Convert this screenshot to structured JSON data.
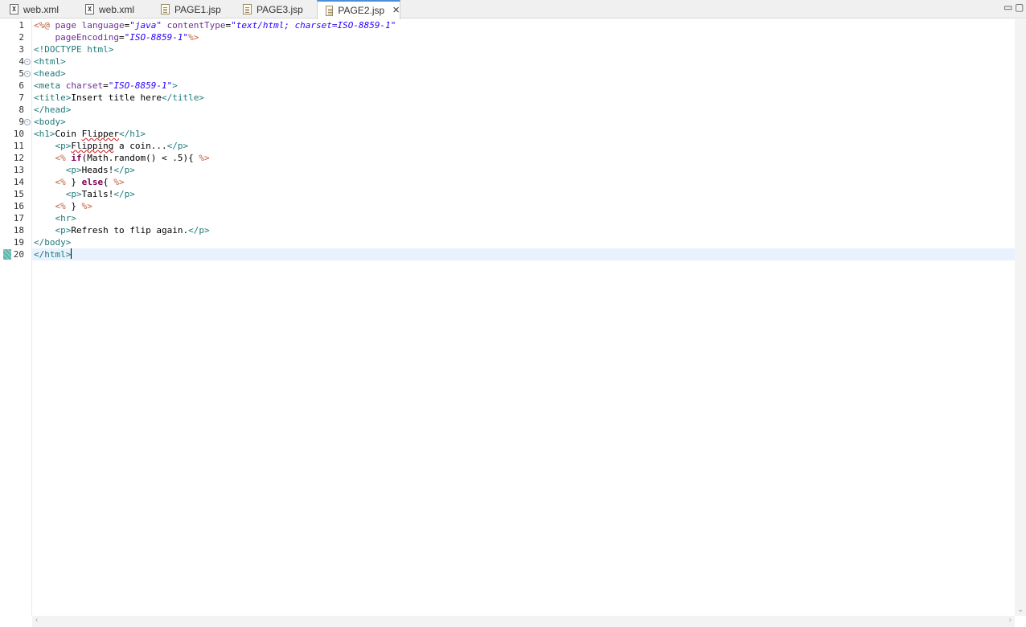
{
  "tabs": [
    {
      "label": "web.xml",
      "icon": "xml-file-icon",
      "active": false
    },
    {
      "label": "web.xml",
      "icon": "xml-file-icon",
      "active": false
    },
    {
      "label": "PAGE1.jsp",
      "icon": "jsp-file-icon",
      "active": false
    },
    {
      "label": "PAGE3.jsp",
      "icon": "jsp-file-icon",
      "active": false
    },
    {
      "label": "PAGE2.jsp",
      "icon": "jsp-file-icon",
      "active": true
    }
  ],
  "window_controls": {
    "minimize": "▭",
    "maximize": "▢"
  },
  "editor": {
    "line_numbers": [
      "1",
      "2",
      "3",
      "4",
      "5",
      "6",
      "7",
      "8",
      "9",
      "10",
      "11",
      "12",
      "13",
      "14",
      "15",
      "16",
      "17",
      "18",
      "19",
      "20"
    ],
    "folded_lines": [
      4,
      5,
      9
    ],
    "current_line": 20,
    "lines": [
      [
        [
          "jsp",
          "<%@ "
        ],
        [
          "attr",
          "page "
        ],
        [
          "attr",
          "language"
        ],
        [
          "txt",
          "="
        ],
        [
          "str",
          "\"java\""
        ],
        [
          "txt",
          " "
        ],
        [
          "attr",
          "contentType"
        ],
        [
          "txt",
          "="
        ],
        [
          "str",
          "\"text/html; charset=ISO-8859-1\""
        ]
      ],
      [
        [
          "txt",
          "    "
        ],
        [
          "attr",
          "pageEncoding"
        ],
        [
          "txt",
          "="
        ],
        [
          "str",
          "\"ISO-8859-1\""
        ],
        [
          "jsp",
          "%>"
        ]
      ],
      [
        [
          "tag",
          "<!DOCTYPE html>"
        ]
      ],
      [
        [
          "tag",
          "<html>"
        ]
      ],
      [
        [
          "tag",
          "<head>"
        ]
      ],
      [
        [
          "tag",
          "<meta "
        ],
        [
          "attr",
          "charset"
        ],
        [
          "txt",
          "="
        ],
        [
          "str",
          "\"ISO-8859-1\""
        ],
        [
          "tag",
          ">"
        ]
      ],
      [
        [
          "tag",
          "<title>"
        ],
        [
          "txt",
          "Insert title here"
        ],
        [
          "tag",
          "</title>"
        ]
      ],
      [
        [
          "tag",
          "</head>"
        ]
      ],
      [
        [
          "tag",
          "<body>"
        ]
      ],
      [
        [
          "tag",
          "<h1>"
        ],
        [
          "txt",
          "Coin "
        ],
        [
          "typo",
          "Flipper"
        ],
        [
          "tag",
          "</h1>"
        ]
      ],
      [
        [
          "txt",
          "    "
        ],
        [
          "tag",
          "<p>"
        ],
        [
          "typo",
          "Flipping"
        ],
        [
          "txt",
          " a coin..."
        ],
        [
          "tag",
          "</p>"
        ]
      ],
      [
        [
          "txt",
          "    "
        ],
        [
          "jsp",
          "<% "
        ],
        [
          "kw",
          "if"
        ],
        [
          "txt",
          "(Math.random() < .5){ "
        ],
        [
          "jsp",
          "%>"
        ]
      ],
      [
        [
          "txt",
          "      "
        ],
        [
          "tag",
          "<p>"
        ],
        [
          "txt",
          "Heads!"
        ],
        [
          "tag",
          "</p>"
        ]
      ],
      [
        [
          "txt",
          "    "
        ],
        [
          "jsp",
          "<% "
        ],
        [
          "txt",
          "} "
        ],
        [
          "kw",
          "else"
        ],
        [
          "txt",
          "{ "
        ],
        [
          "jsp",
          "%>"
        ]
      ],
      [
        [
          "txt",
          "      "
        ],
        [
          "tag",
          "<p>"
        ],
        [
          "txt",
          "Tails!"
        ],
        [
          "tag",
          "</p>"
        ]
      ],
      [
        [
          "txt",
          "    "
        ],
        [
          "jsp",
          "<% "
        ],
        [
          "txt",
          "} "
        ],
        [
          "jsp",
          "%>"
        ]
      ],
      [
        [
          "txt",
          "    "
        ],
        [
          "tag",
          "<hr>"
        ]
      ],
      [
        [
          "txt",
          "    "
        ],
        [
          "tag",
          "<p>"
        ],
        [
          "txt",
          "Refresh to flip again."
        ],
        [
          "tag",
          "</p>"
        ]
      ],
      [
        [
          "tag",
          "</body>"
        ]
      ],
      [
        [
          "tag",
          "</html>"
        ]
      ]
    ]
  },
  "colors": {
    "tag": "#1f7a7a",
    "attribute": "#6e2e96",
    "string": "#2a00ff",
    "jsp_delimiter": "#bf5f3f",
    "keyword": "#7f0055",
    "current_line_bg": "#e8f2fe",
    "active_tab_accent": "#4a8fd8"
  }
}
